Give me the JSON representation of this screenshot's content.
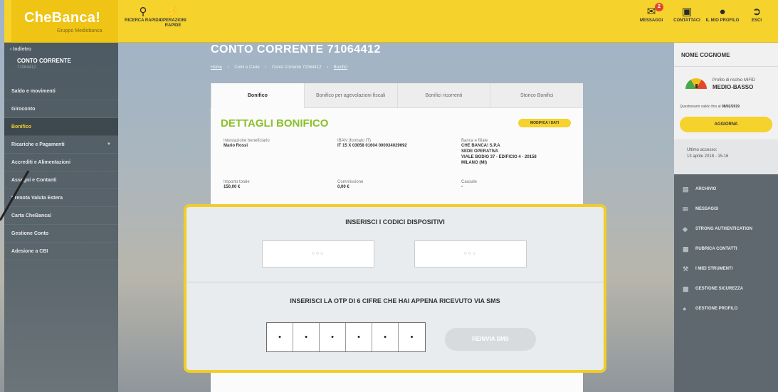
{
  "header": {
    "brand": "CheBanca!",
    "brand_sub": "Gruppo Mediobanca",
    "search_label": "RICERCA RAPIDA",
    "quick_ops_label": "OPERAZIONI RAPIDE",
    "messages_label": "MESSAGGI",
    "messages_count": "2",
    "contact_label": "CONTATTACI",
    "profile_label": "IL MIO PROFILO",
    "exit_label": "ESCI"
  },
  "sidebar": {
    "back": "‹ Indietro",
    "account_title": "CONTO CORRENTE",
    "account_number": "71064412",
    "items": [
      {
        "label": "Saldo e movimenti"
      },
      {
        "label": "Giroconto"
      },
      {
        "label": "Bonifico"
      },
      {
        "label": "Ricariche e Pagamenti"
      },
      {
        "label": "Accrediti e Alimentazioni"
      },
      {
        "label": "Assegni e Contanti"
      },
      {
        "label": "Prenota Valuta Estera"
      },
      {
        "label": "Carta CheBanca!"
      },
      {
        "label": "Gestione Conto"
      },
      {
        "label": "Adesione a CBI"
      }
    ]
  },
  "main": {
    "title": "CONTO CORRENTE 71064412",
    "breadcrumb": [
      "Home",
      "›",
      "Conti e Carte",
      "›",
      "Conto Corrente 71064412",
      "›",
      "Bonifici"
    ],
    "tabs": [
      "Bonifico",
      "Bonifico per agevolazioni fiscali",
      "Bonifici ricorrenti",
      "Storico Bonifici"
    ],
    "details_title": "DETTAGLI BONIFICO",
    "edit_button": "MODIFICA I DATI",
    "beneficiary_label": "Intestazione beneficiario",
    "beneficiary_value": "Mario Rossi",
    "iban_label": "IBAN (formato IT)",
    "iban_value": "IT 15 X 03058 01604 000034029692",
    "bank_label": "Banca e filiale",
    "bank_value": [
      "CHE BANCA! S.P.A",
      "SEDE OPERATIVA",
      "VIALE BODIO 37 - EDIFICIO 4 - 20158",
      "MILANO (MI)"
    ],
    "amount_label": "Importo totale",
    "amount_value": "150,00 €",
    "fee_label": "Commissione",
    "fee_value": "0,00 €",
    "reason_label": "Causale",
    "reason_value": "-"
  },
  "modal": {
    "codes_title": "INSERISCI I CODICI DISPOSITIVI",
    "code1_placeholder": "○○○",
    "code2_placeholder": "○○○",
    "otp_title": "INSERISCI LA OTP DI 6 CIFRE CHE HAI APPENA RICEVUTO VIA SMS",
    "otp_digits": [
      "•",
      "•",
      "•",
      "•",
      "•",
      "•"
    ],
    "resend_button": "REINVIA SMS"
  },
  "right": {
    "name": "NOME COGNOME",
    "risk_label": "Profilo di rischio MiFID",
    "risk_value": "MEDIO-BASSO",
    "questionnaire_prefix": "Questionario valido fino al",
    "questionnaire_date": "08/02/2019",
    "update_button": "AGGIORNA",
    "last_access_label": "Ultimo accesso:",
    "last_access_value": "13 aprile 2018 - 15.16",
    "menu": [
      {
        "label": "ARCHIVIO",
        "icon": "archive-icon"
      },
      {
        "label": "MESSAGGI",
        "icon": "mail-icon"
      },
      {
        "label": "STRONG AUTHENTICATION",
        "icon": "shield-icon"
      },
      {
        "label": "RUBRICA CONTATTI",
        "icon": "address-book-icon"
      },
      {
        "label": "I MIEI STRUMENTI",
        "icon": "wrench-icon"
      },
      {
        "label": "GESTIONE SICUREZZA",
        "icon": "lock-icon"
      },
      {
        "label": "GESTIONE PROFILO",
        "icon": "user-icon"
      }
    ]
  },
  "colors": {
    "brand_yellow": "#f6d22c",
    "success_green": "#8cbf2a",
    "sidebar_dark": "#4e5a63"
  }
}
